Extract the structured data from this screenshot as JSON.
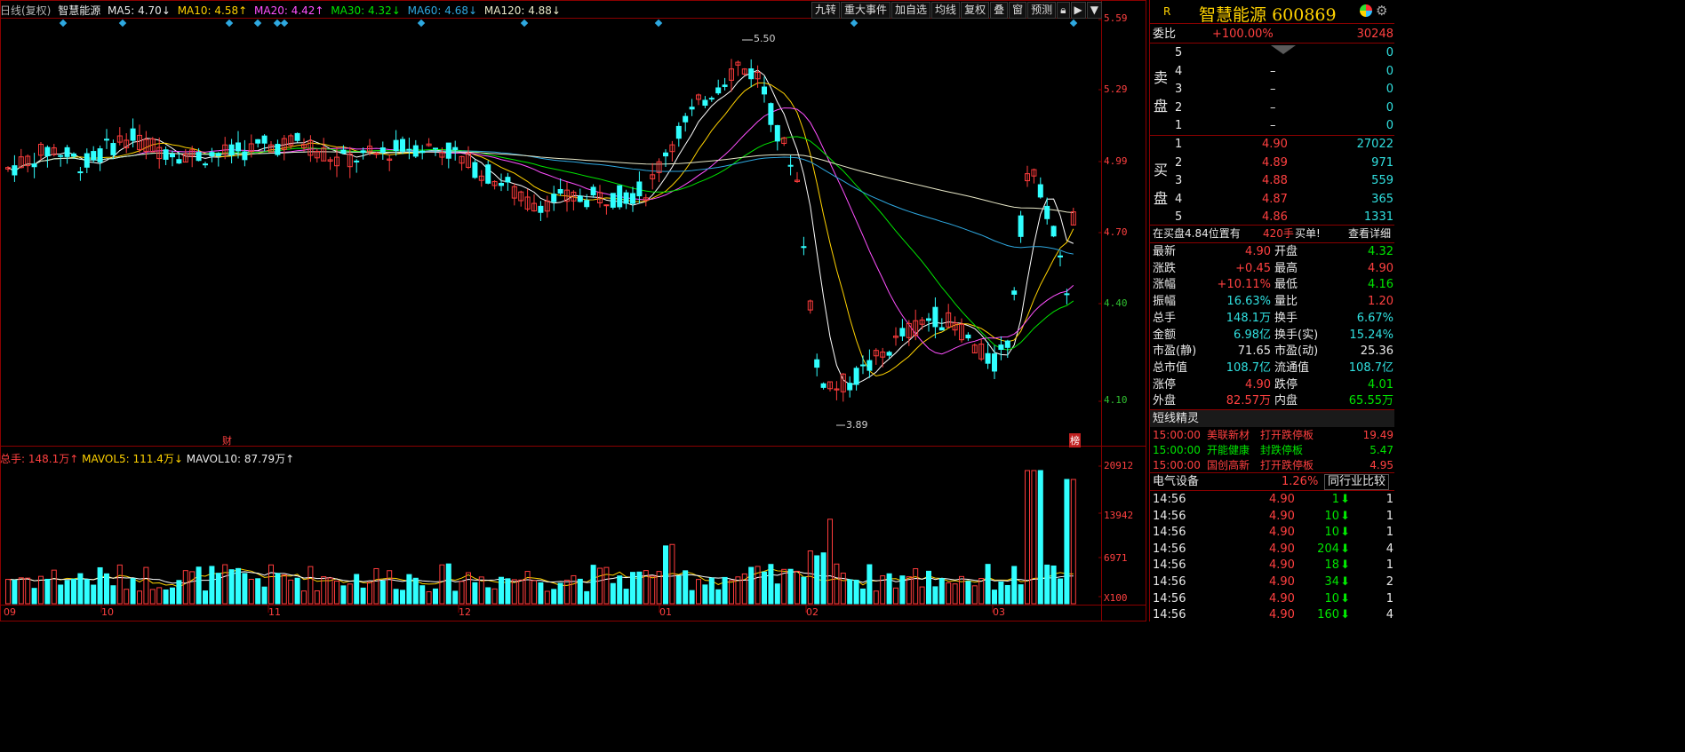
{
  "legend": {
    "title": "日线(复权)",
    "stock_name": "智慧能源",
    "ma5": "MA5: 4.70↓",
    "ma10": "MA10: 4.58↑",
    "ma20": "MA20: 4.42↑",
    "ma30": "MA30: 4.32↓",
    "ma60": "MA60: 4.68↓",
    "ma120": "MA120: 4.88↓"
  },
  "toolbar": [
    "九转",
    "重大事件",
    "加自选",
    "均线",
    "复权",
    "叠",
    "窗",
    "预测"
  ],
  "price_axis": [
    "5.59",
    "5.29",
    "4.99",
    "4.70",
    "4.40",
    "4.10"
  ],
  "price_marks": {
    "high": "5.50",
    "low": "3.89"
  },
  "event_marks": {
    "cai": "财",
    "bang": "榜"
  },
  "volume_legend": {
    "total": "总手: 148.1万↑",
    "mavol5": "MAVOL5: 111.4万↓",
    "mavol10": "MAVOL10: 87.79万↑"
  },
  "volume_axis": [
    "20912",
    "13942",
    "6971",
    "X100"
  ],
  "date_axis": [
    "09",
    "10",
    "11",
    "12",
    "01",
    "02",
    "03"
  ],
  "colors": {
    "up": "#ff3c3c",
    "down": "#30ffff",
    "ma5": "#ffffff",
    "ma10": "#ffd200",
    "ma20": "#ff50ff",
    "ma30": "#00e600",
    "ma60": "#2ea8e0",
    "ma120": "#e8e8c8",
    "frame": "#8b0000"
  },
  "chart_data": {
    "type": "candlestick",
    "title": "智慧能源 日线(复权)",
    "ylim": [
      3.89,
      5.59
    ],
    "series": [
      {
        "name": "MA5",
        "last": 4.7
      },
      {
        "name": "MA10",
        "last": 4.58
      },
      {
        "name": "MA20",
        "last": 4.42
      },
      {
        "name": "MA30",
        "last": 4.32
      },
      {
        "name": "MA60",
        "last": 4.68
      },
      {
        "name": "MA120",
        "last": 4.88
      }
    ],
    "x": [
      "09",
      "10",
      "11",
      "12",
      "01",
      "02",
      "03"
    ],
    "high": 5.5,
    "low": 3.89,
    "volume_ylim": [
      0,
      20912
    ]
  },
  "panel": {
    "r_label": "R",
    "name": "智慧能源",
    "code": "600869",
    "weibi_label": "委比",
    "weibi_pct": "+100.00%",
    "weibi_val": "30248",
    "sell_side_chars": [
      "卖",
      "盘"
    ],
    "buy_side_chars": [
      "买",
      "盘"
    ],
    "sells": [
      {
        "lvl": "5",
        "price": "",
        "vol": "0"
      },
      {
        "lvl": "4",
        "price": "–",
        "vol": "0"
      },
      {
        "lvl": "3",
        "price": "–",
        "vol": "0"
      },
      {
        "lvl": "2",
        "price": "–",
        "vol": "0"
      },
      {
        "lvl": "1",
        "price": "–",
        "vol": "0"
      }
    ],
    "buys": [
      {
        "lvl": "1",
        "price": "4.90",
        "vol": "27022"
      },
      {
        "lvl": "2",
        "price": "4.89",
        "vol": "971"
      },
      {
        "lvl": "3",
        "price": "4.88",
        "vol": "559"
      },
      {
        "lvl": "4",
        "price": "4.87",
        "vol": "365"
      },
      {
        "lvl": "5",
        "price": "4.86",
        "vol": "1331"
      }
    ],
    "notice": {
      "text": "在买盘4.84位置有",
      "vol": "420手",
      "action": "买单!",
      "detail": "查看详细"
    },
    "quotes": [
      {
        "l1": "最新",
        "v1": "4.90",
        "c1": "red",
        "l2": "开盘",
        "v2": "4.32",
        "c2": "green"
      },
      {
        "l1": "涨跌",
        "v1": "+0.45",
        "c1": "red",
        "l2": "最高",
        "v2": "4.90",
        "c2": "red"
      },
      {
        "l1": "涨幅",
        "v1": "+10.11%",
        "c1": "red",
        "l2": "最低",
        "v2": "4.16",
        "c2": "green"
      },
      {
        "l1": "振幅",
        "v1": "16.63%",
        "c1": "cyan",
        "l2": "量比",
        "v2": "1.20",
        "c2": "red"
      },
      {
        "l1": "总手",
        "v1": "148.1万",
        "c1": "cyan",
        "l2": "换手",
        "v2": "6.67%",
        "c2": "cyan"
      },
      {
        "l1": "金额",
        "v1": "6.98亿",
        "c1": "cyan",
        "l2": "换手(实)",
        "v2": "15.24%",
        "c2": "cyan"
      },
      {
        "l1": "市盈(静)",
        "v1": "71.65",
        "c1": "white",
        "l2": "市盈(动)",
        "v2": "25.36",
        "c2": "white"
      },
      {
        "l1": "总市值",
        "v1": "108.7亿",
        "c1": "cyan",
        "l2": "流通值",
        "v2": "108.7亿",
        "c2": "cyan"
      },
      {
        "l1": "涨停",
        "v1": "4.90",
        "c1": "red",
        "l2": "跌停",
        "v2": "4.01",
        "c2": "green"
      },
      {
        "l1": "外盘",
        "v1": "82.57万",
        "c1": "red",
        "l2": "内盘",
        "v2": "65.55万",
        "c2": "green"
      }
    ],
    "short_title": "短线精灵",
    "short_items": [
      {
        "time": "15:00:00",
        "name": "美联新材",
        "event": "打开跌停板",
        "val": "19.49",
        "tc": "red",
        "nc": "red",
        "ec": "red"
      },
      {
        "time": "15:00:00",
        "name": "开能健康",
        "event": "封跌停板",
        "val": "5.47",
        "tc": "green",
        "nc": "green",
        "ec": "green"
      },
      {
        "time": "15:00:00",
        "name": "国创高新",
        "event": "打开跌停板",
        "val": "4.95",
        "tc": "red",
        "nc": "red",
        "ec": "red"
      }
    ],
    "sector": {
      "name": "电气设备",
      "pct": "1.26%",
      "compare": "同行业比较"
    },
    "ticks": [
      {
        "time": "14:56",
        "price": "4.90",
        "vol": "1",
        "n": "1"
      },
      {
        "time": "14:56",
        "price": "4.90",
        "vol": "10",
        "n": "1"
      },
      {
        "time": "14:56",
        "price": "4.90",
        "vol": "10",
        "n": "1"
      },
      {
        "time": "14:56",
        "price": "4.90",
        "vol": "204",
        "n": "4"
      },
      {
        "time": "14:56",
        "price": "4.90",
        "vol": "18",
        "n": "1"
      },
      {
        "time": "14:56",
        "price": "4.90",
        "vol": "34",
        "n": "2"
      },
      {
        "time": "14:56",
        "price": "4.90",
        "vol": "10",
        "n": "1"
      },
      {
        "time": "14:56",
        "price": "4.90",
        "vol": "160",
        "n": "4"
      }
    ]
  }
}
